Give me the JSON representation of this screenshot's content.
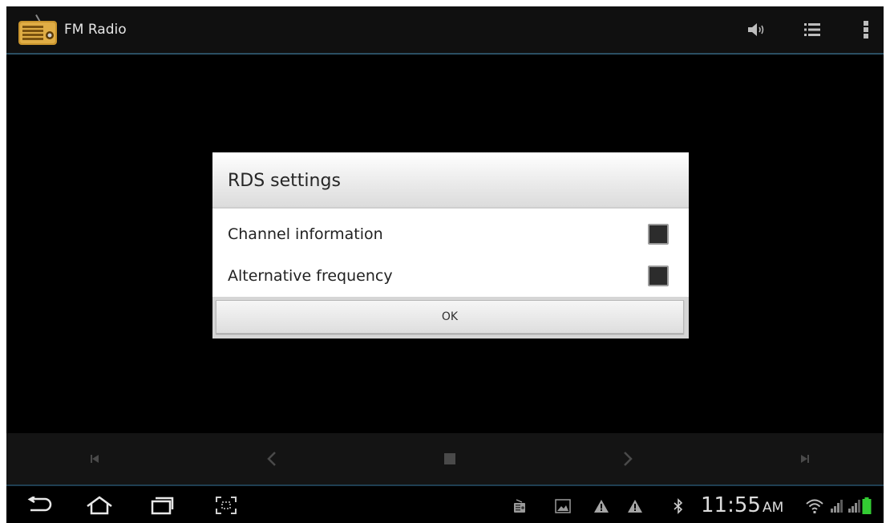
{
  "action_bar": {
    "title": "FM Radio",
    "icons": [
      "radio-app-icon",
      "speaker-icon",
      "list-icon",
      "overflow-menu-icon"
    ]
  },
  "dialog": {
    "title": "RDS settings",
    "options": [
      {
        "label": "Channel information",
        "checked": false
      },
      {
        "label": "Alternative frequency",
        "checked": false
      }
    ],
    "ok_label": "OK"
  },
  "controls": {
    "icons": [
      "skip-first-icon",
      "previous-icon",
      "stop-icon",
      "next-icon",
      "skip-last-icon"
    ]
  },
  "system_bar": {
    "time": "11:55",
    "ampm": "AM",
    "nav_icons": [
      "back-icon",
      "home-icon",
      "recent-apps-icon",
      "screenshot-icon"
    ],
    "status_icons": [
      "radio-notification-icon",
      "gallery-icon",
      "warning-icon",
      "warning-icon",
      "bluetooth-icon",
      "wifi-icon",
      "signal-icon",
      "signal-icon",
      "battery-icon"
    ]
  },
  "colors": {
    "action_bar_bg": "#101010",
    "accent_line": "#2b4f63",
    "battery": "#33cc33"
  }
}
